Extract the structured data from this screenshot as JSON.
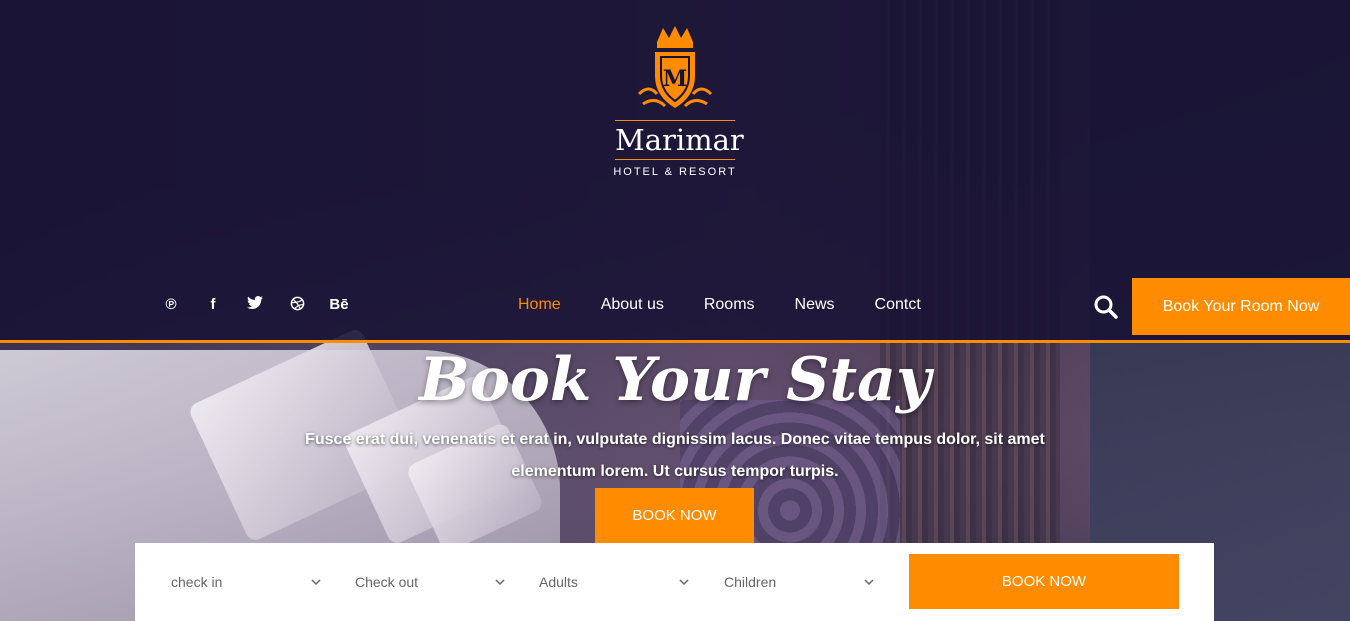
{
  "colors": {
    "accent": "#ff8c00",
    "header_overlay": "#181234",
    "field_text": "#666666"
  },
  "logo": {
    "monogram": "M",
    "name": "Marimar",
    "tagline": "HOTEL & RESORT"
  },
  "social": [
    {
      "icon": "pinterest-icon",
      "glyph": "℗"
    },
    {
      "icon": "facebook-icon",
      "glyph": "f"
    },
    {
      "icon": "twitter-icon",
      "glyph": "🐦"
    },
    {
      "icon": "dribbble-icon",
      "glyph": "◍"
    },
    {
      "icon": "behance-icon",
      "glyph": "Bē"
    }
  ],
  "nav": [
    {
      "label": "Home",
      "active": true
    },
    {
      "label": "About us",
      "active": false
    },
    {
      "label": "Rooms",
      "active": false
    },
    {
      "label": "News",
      "active": false
    },
    {
      "label": "Contct",
      "active": false
    }
  ],
  "header": {
    "search_icon": "search-icon",
    "book_room_label": "Book Your Room Now"
  },
  "hero": {
    "title": "Book Your Stay",
    "text": "Fusce erat dui, venenatis et erat in, vulputate dignissim lacus. Donec vitae tempus dolor, sit amet elementum lorem. Ut cursus tempor turpis.",
    "book_label": "BOOK NOW"
  },
  "booking": {
    "fields": [
      {
        "label": "check in"
      },
      {
        "label": "Check out"
      },
      {
        "label": "Adults"
      },
      {
        "label": "Children"
      }
    ],
    "submit_label": "BOOK NOW"
  }
}
